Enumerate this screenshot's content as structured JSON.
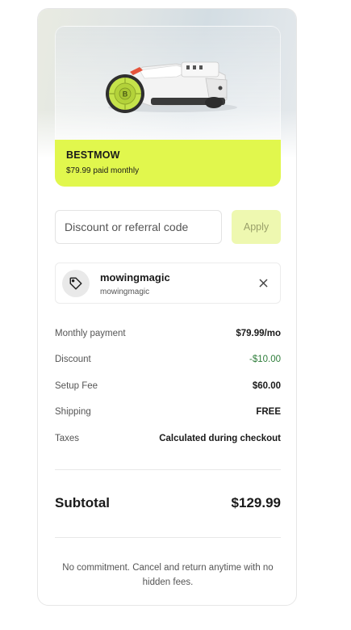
{
  "product": {
    "name": "BESTMOW",
    "price_text": "$79.99 paid monthly",
    "wheel_badge": "B",
    "accent_color": "#e1f74d"
  },
  "discount_code": {
    "placeholder": "Discount or referral code",
    "value": "",
    "apply_label": "Apply"
  },
  "applied_code": {
    "title": "mowingmagic",
    "subtitle": "mowingmagic",
    "icon": "tag-icon",
    "remove_icon": "close-icon"
  },
  "summary": {
    "rows": [
      {
        "label": "Monthly payment",
        "value": "$79.99/mo"
      },
      {
        "label": "Discount",
        "value": "-$10.00"
      },
      {
        "label": "Setup Fee",
        "value": "$60.00"
      },
      {
        "label": "Shipping",
        "value": "FREE"
      },
      {
        "label": "Taxes",
        "value": "Calculated during checkout"
      }
    ],
    "discount_color": "#2e7d3a"
  },
  "subtotal": {
    "label": "Subtotal",
    "value": "$129.99"
  },
  "footer": {
    "note": "No commitment. Cancel and return anytime with no hidden fees."
  }
}
